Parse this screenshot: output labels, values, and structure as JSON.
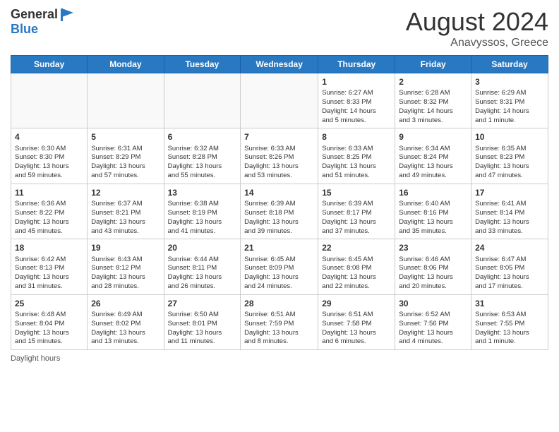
{
  "header": {
    "logo_general": "General",
    "logo_blue": "Blue",
    "month_year": "August 2024",
    "location": "Anavyssos, Greece"
  },
  "days_of_week": [
    "Sunday",
    "Monday",
    "Tuesday",
    "Wednesday",
    "Thursday",
    "Friday",
    "Saturday"
  ],
  "weeks": [
    [
      {
        "day": "",
        "info": ""
      },
      {
        "day": "",
        "info": ""
      },
      {
        "day": "",
        "info": ""
      },
      {
        "day": "",
        "info": ""
      },
      {
        "day": "1",
        "info": "Sunrise: 6:27 AM\nSunset: 8:33 PM\nDaylight: 14 hours\nand 5 minutes."
      },
      {
        "day": "2",
        "info": "Sunrise: 6:28 AM\nSunset: 8:32 PM\nDaylight: 14 hours\nand 3 minutes."
      },
      {
        "day": "3",
        "info": "Sunrise: 6:29 AM\nSunset: 8:31 PM\nDaylight: 14 hours\nand 1 minute."
      }
    ],
    [
      {
        "day": "4",
        "info": "Sunrise: 6:30 AM\nSunset: 8:30 PM\nDaylight: 13 hours\nand 59 minutes."
      },
      {
        "day": "5",
        "info": "Sunrise: 6:31 AM\nSunset: 8:29 PM\nDaylight: 13 hours\nand 57 minutes."
      },
      {
        "day": "6",
        "info": "Sunrise: 6:32 AM\nSunset: 8:28 PM\nDaylight: 13 hours\nand 55 minutes."
      },
      {
        "day": "7",
        "info": "Sunrise: 6:33 AM\nSunset: 8:26 PM\nDaylight: 13 hours\nand 53 minutes."
      },
      {
        "day": "8",
        "info": "Sunrise: 6:33 AM\nSunset: 8:25 PM\nDaylight: 13 hours\nand 51 minutes."
      },
      {
        "day": "9",
        "info": "Sunrise: 6:34 AM\nSunset: 8:24 PM\nDaylight: 13 hours\nand 49 minutes."
      },
      {
        "day": "10",
        "info": "Sunrise: 6:35 AM\nSunset: 8:23 PM\nDaylight: 13 hours\nand 47 minutes."
      }
    ],
    [
      {
        "day": "11",
        "info": "Sunrise: 6:36 AM\nSunset: 8:22 PM\nDaylight: 13 hours\nand 45 minutes."
      },
      {
        "day": "12",
        "info": "Sunrise: 6:37 AM\nSunset: 8:21 PM\nDaylight: 13 hours\nand 43 minutes."
      },
      {
        "day": "13",
        "info": "Sunrise: 6:38 AM\nSunset: 8:19 PM\nDaylight: 13 hours\nand 41 minutes."
      },
      {
        "day": "14",
        "info": "Sunrise: 6:39 AM\nSunset: 8:18 PM\nDaylight: 13 hours\nand 39 minutes."
      },
      {
        "day": "15",
        "info": "Sunrise: 6:39 AM\nSunset: 8:17 PM\nDaylight: 13 hours\nand 37 minutes."
      },
      {
        "day": "16",
        "info": "Sunrise: 6:40 AM\nSunset: 8:16 PM\nDaylight: 13 hours\nand 35 minutes."
      },
      {
        "day": "17",
        "info": "Sunrise: 6:41 AM\nSunset: 8:14 PM\nDaylight: 13 hours\nand 33 minutes."
      }
    ],
    [
      {
        "day": "18",
        "info": "Sunrise: 6:42 AM\nSunset: 8:13 PM\nDaylight: 13 hours\nand 31 minutes."
      },
      {
        "day": "19",
        "info": "Sunrise: 6:43 AM\nSunset: 8:12 PM\nDaylight: 13 hours\nand 28 minutes."
      },
      {
        "day": "20",
        "info": "Sunrise: 6:44 AM\nSunset: 8:11 PM\nDaylight: 13 hours\nand 26 minutes."
      },
      {
        "day": "21",
        "info": "Sunrise: 6:45 AM\nSunset: 8:09 PM\nDaylight: 13 hours\nand 24 minutes."
      },
      {
        "day": "22",
        "info": "Sunrise: 6:45 AM\nSunset: 8:08 PM\nDaylight: 13 hours\nand 22 minutes."
      },
      {
        "day": "23",
        "info": "Sunrise: 6:46 AM\nSunset: 8:06 PM\nDaylight: 13 hours\nand 20 minutes."
      },
      {
        "day": "24",
        "info": "Sunrise: 6:47 AM\nSunset: 8:05 PM\nDaylight: 13 hours\nand 17 minutes."
      }
    ],
    [
      {
        "day": "25",
        "info": "Sunrise: 6:48 AM\nSunset: 8:04 PM\nDaylight: 13 hours\nand 15 minutes."
      },
      {
        "day": "26",
        "info": "Sunrise: 6:49 AM\nSunset: 8:02 PM\nDaylight: 13 hours\nand 13 minutes."
      },
      {
        "day": "27",
        "info": "Sunrise: 6:50 AM\nSunset: 8:01 PM\nDaylight: 13 hours\nand 11 minutes."
      },
      {
        "day": "28",
        "info": "Sunrise: 6:51 AM\nSunset: 7:59 PM\nDaylight: 13 hours\nand 8 minutes."
      },
      {
        "day": "29",
        "info": "Sunrise: 6:51 AM\nSunset: 7:58 PM\nDaylight: 13 hours\nand 6 minutes."
      },
      {
        "day": "30",
        "info": "Sunrise: 6:52 AM\nSunset: 7:56 PM\nDaylight: 13 hours\nand 4 minutes."
      },
      {
        "day": "31",
        "info": "Sunrise: 6:53 AM\nSunset: 7:55 PM\nDaylight: 13 hours\nand 1 minute."
      }
    ]
  ],
  "footer": {
    "daylight_label": "Daylight hours"
  }
}
